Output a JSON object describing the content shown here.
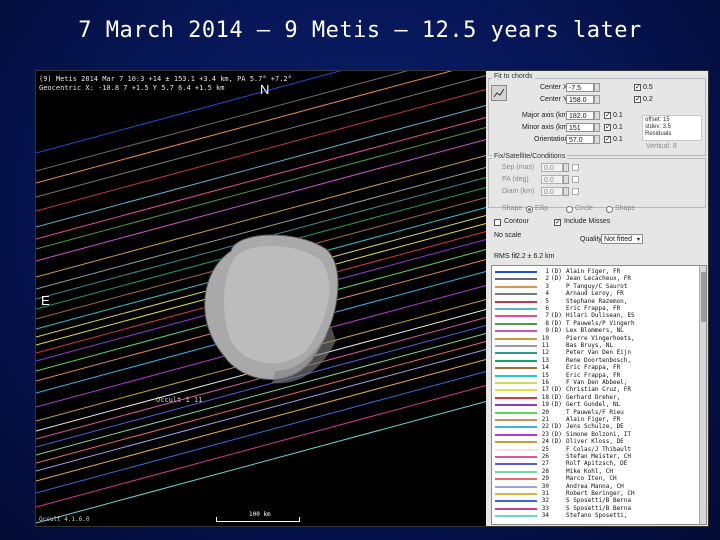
{
  "slide_title": "7 March 2014 – 9 Metis – 12.5 years later",
  "plot": {
    "header_line1": "(9) Metis  2014 Mar 7  10:3 +14 ± 153.1 +3.4 km, PA 5.7° +7.2°",
    "header_line2": "Geocentric  X: -10.8  7 +1.5  Y 5.7  6.4 +1.5 km",
    "north_label": "N",
    "east_label": "E",
    "chord_label": "Occult 1  11",
    "footer_left": "Occult 4.1.6.0",
    "scale_label": "100 km"
  },
  "panel": {
    "group_fit_title": "Fit to chords",
    "center_x_label": "Center X",
    "center_x_value": "-7.5",
    "center_y_label": "Center Y",
    "center_y_value": "158.0",
    "major_axis_label": "Major axis (km)",
    "major_axis_value": "182.0",
    "minor_axis_label": "Minor axis (km)",
    "minor_axis_value": "151",
    "orientation_label": "Orientation",
    "orientation_value": "57.0",
    "chk_right_1": "0.5",
    "chk_right_2": "0.2",
    "chk_right_3": "0.1",
    "chk_right_4": "0.1",
    "chk_right_5": "0.1",
    "side_info_line1": "offset: 15",
    "side_info_line2": "stdev: 3.5",
    "side_info_line3": "Residuals",
    "side_info_line4": "Vertical: 8",
    "group_sat_title": "Fix/Satellite/Conditions",
    "sep_label": "Sep (mas)",
    "sep_value": "0.0",
    "pa_label": "PA (deg)",
    "pa_value": "0.0",
    "diam_label": "Diam (km)",
    "diam_value": "0.0",
    "shape_label": "Shape",
    "shape_opt1": "Ellip",
    "shape_opt2": "Circle",
    "shape_opt3": "Shape",
    "contour_label": "Contour",
    "include_misses_label": "Include Misses",
    "shape_model_label": "No scale",
    "quality_label": "Quality",
    "quality_value": "Not fitted",
    "rms_label": "RMS fit",
    "rms_value": "2.2 ± 6.2 km",
    "chords": [
      {
        "num": "1",
        "flag": "(D)",
        "obs": "Alain Figer, FR",
        "color": "#1d4fd8"
      },
      {
        "num": "2",
        "flag": "(D)",
        "obs": "Jean Lecacheux, FR",
        "color": "#6b6b6b"
      },
      {
        "num": "3",
        "flag": "",
        "obs": "P Tanguy/C Saurot",
        "color": "#e88f3a"
      },
      {
        "num": "4",
        "flag": "",
        "obs": "Arnaud Leroy, FR",
        "color": "#7a7a7a"
      },
      {
        "num": "5",
        "flag": "",
        "obs": "Stephane Razemon,",
        "color": "#c03a3a"
      },
      {
        "num": "6",
        "flag": "",
        "obs": "Eric Frappa, FR",
        "color": "#5fb3c9"
      },
      {
        "num": "7",
        "flag": "(D)",
        "obs": "Hilari Dulisean, ES",
        "color": "#e74c9a"
      },
      {
        "num": "8",
        "flag": "(D)",
        "obs": "T Pauwels/P Vingerh",
        "color": "#4b9b4b"
      },
      {
        "num": "9",
        "flag": "(D)",
        "obs": "Lex Blommers, NL",
        "color": "#cc55cc"
      },
      {
        "num": "10",
        "flag": "",
        "obs": "Pierre Vingerhoets,",
        "color": "#cc9a3a"
      },
      {
        "num": "11",
        "flag": "",
        "obs": "Bas Bruys, NL",
        "color": "#9a9a9a"
      },
      {
        "num": "12",
        "flag": "",
        "obs": "Peter Van Den Eijn",
        "color": "#3a8f8f"
      },
      {
        "num": "13",
        "flag": "",
        "obs": "Rene Doortenbosch,",
        "color": "#1a9e6a"
      },
      {
        "num": "14",
        "flag": "",
        "obs": "Eric Frappa, FR",
        "color": "#a06a3a"
      },
      {
        "num": "15",
        "flag": "",
        "obs": "Eric Frappa, FR",
        "color": "#2ec4c4"
      },
      {
        "num": "16",
        "flag": "",
        "obs": "F Van Den Abbeel,",
        "color": "#d4d45a"
      },
      {
        "num": "17",
        "flag": "(D)",
        "obs": "Christian Cruz, FR",
        "color": "#e3e32a"
      },
      {
        "num": "18",
        "flag": "(D)",
        "obs": "Gerhard Dreher,",
        "color": "#d43a3a"
      },
      {
        "num": "19",
        "flag": "(D)",
        "obs": "Gert Gundel, NL",
        "color": "#8a3ad4"
      },
      {
        "num": "20",
        "flag": "",
        "obs": "T Pauwels/F Rieu",
        "color": "#5fd45f"
      },
      {
        "num": "21",
        "flag": "",
        "obs": "Alain Figer, FR",
        "color": "#d48a5a"
      },
      {
        "num": "22",
        "flag": "(D)",
        "obs": "Jens Schulze, DE",
        "color": "#3ab4e8"
      },
      {
        "num": "23",
        "flag": "(D)",
        "obs": "Simone Bolzoni, IT",
        "color": "#b43ad4"
      },
      {
        "num": "24",
        "flag": "(D)",
        "obs": "Oliver Kloss, DE",
        "color": "#c4a03a"
      },
      {
        "num": "25",
        "flag": "",
        "obs": "F Colas/J Thibault",
        "color": "#e8e8e8"
      },
      {
        "num": "26",
        "flag": "",
        "obs": "Stefan Meister, CH",
        "color": "#d45aa0"
      },
      {
        "num": "27",
        "flag": "",
        "obs": "Rolf Apitzsch, DE",
        "color": "#5a5ad4"
      },
      {
        "num": "28",
        "flag": "",
        "obs": "Mike Kohl, CH",
        "color": "#7fd4a0"
      },
      {
        "num": "29",
        "flag": "",
        "obs": "Marco Iten, CH",
        "color": "#e86a6a"
      },
      {
        "num": "30",
        "flag": "",
        "obs": "Andrea Manna, CH",
        "color": "#a0a0e8"
      },
      {
        "num": "31",
        "flag": "",
        "obs": "Robert Beringer, CH",
        "color": "#e8b03a"
      },
      {
        "num": "32",
        "flag": "",
        "obs": "S Sposetti/B Berna",
        "color": "#3a6ad4"
      },
      {
        "num": "33",
        "flag": "",
        "obs": "S Sposetti/B Berna",
        "color": "#d43a8a"
      },
      {
        "num": "34",
        "flag": "",
        "obs": "Stefano Sposetti,",
        "color": "#6ad4d4"
      }
    ]
  }
}
